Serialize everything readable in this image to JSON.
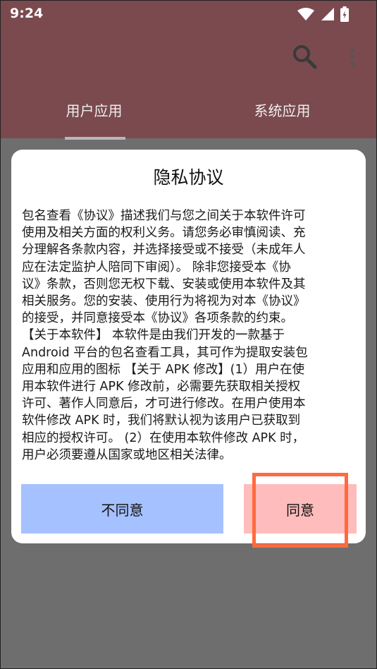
{
  "status_bar": {
    "time": "9:24"
  },
  "tabs": [
    {
      "label": "用户应用"
    },
    {
      "label": "系统应用"
    }
  ],
  "dialog": {
    "title": "隐私协议",
    "body": "包名查看《协议》描述我们与您之间关于本软件许可\n使用及相关方面的权利义务。请您务必审慎阅读、充\n分理解各条款内容，并选择接受或不接受（未成年人\n应在法定监护人陪同下审阅）。 除非您接受本《协\n议》条款，否则您无权下载、安装或使用本软件及其\n相关服务。您的安装、使用行为将视为对本《协议》\n的接受，并同意接受本《协议》各项条款的约束。\n【关于本软件】 本软件是由我们开发的一款基于\nAndroid 平台的包名查看工具，其可作为提取安装包\n应用和应用的图标 【关于 APK 修改】(1）用户在使\n用本软件进行 APK 修改前，必需要先获取相关授权\n许可、著作人同意后，才可进行修改。在用户使用本\n软件修改 APK 时，我们将默认视为该用户已获取到\n相应的授权许可。 (2）在使用本软件修改 APK 时，\n用户必须要遵从国家或地区相关法律。",
    "disagree_label": "不同意",
    "agree_label": "同意"
  },
  "colors": {
    "app_bar": "#7a4a4f",
    "scrim": "#6e6e6e",
    "disagree_button": "#a6c1ff",
    "agree_button": "#ffbcbc",
    "highlight": "#ff6a3d"
  },
  "icons": [
    "wifi-icon",
    "signal-icon",
    "battery-icon",
    "search-icon",
    "more-vert-icon"
  ]
}
